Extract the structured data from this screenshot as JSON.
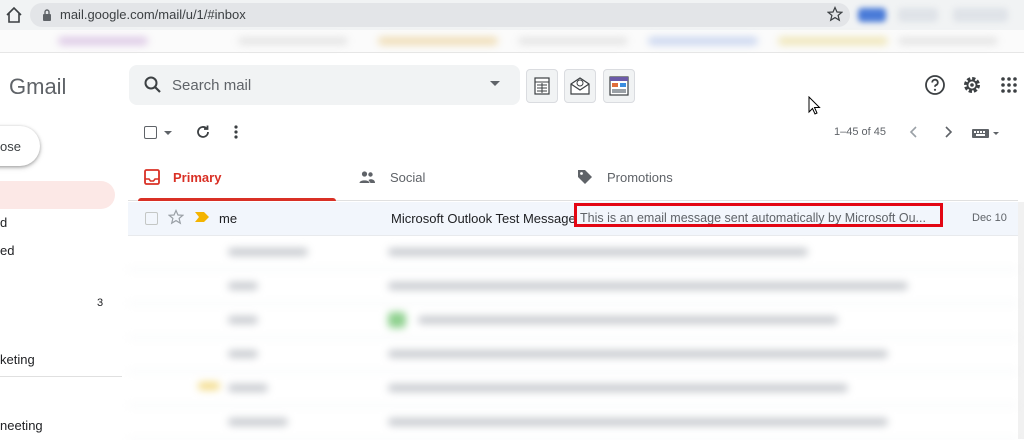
{
  "browser": {
    "url": "mail.google.com/mail/u/1/#inbox"
  },
  "app": {
    "logo_text": "Gmail"
  },
  "search": {
    "placeholder": "Search mail"
  },
  "nav": {
    "compose_label": "ose",
    "items": [
      {
        "label": "d"
      },
      {
        "label": "ed"
      },
      {
        "label": "3"
      },
      {
        "label": "keting"
      },
      {
        "label": "neeting"
      }
    ]
  },
  "toolbar": {
    "pager": "1–45 of 45"
  },
  "tabs": [
    {
      "label": "Primary",
      "active": true
    },
    {
      "label": "Social",
      "active": false
    },
    {
      "label": "Promotions",
      "active": false
    }
  ],
  "emails": [
    {
      "sender": "me",
      "subject": "Microsoft Outlook Test Message",
      "snippet": "This is an email message sent automatically by Microsoft Ou...",
      "date": "Dec 10",
      "important": true
    }
  ],
  "colors": {
    "accent": "#d93025",
    "highlight": "#e30613",
    "importance": "#f4b400"
  }
}
